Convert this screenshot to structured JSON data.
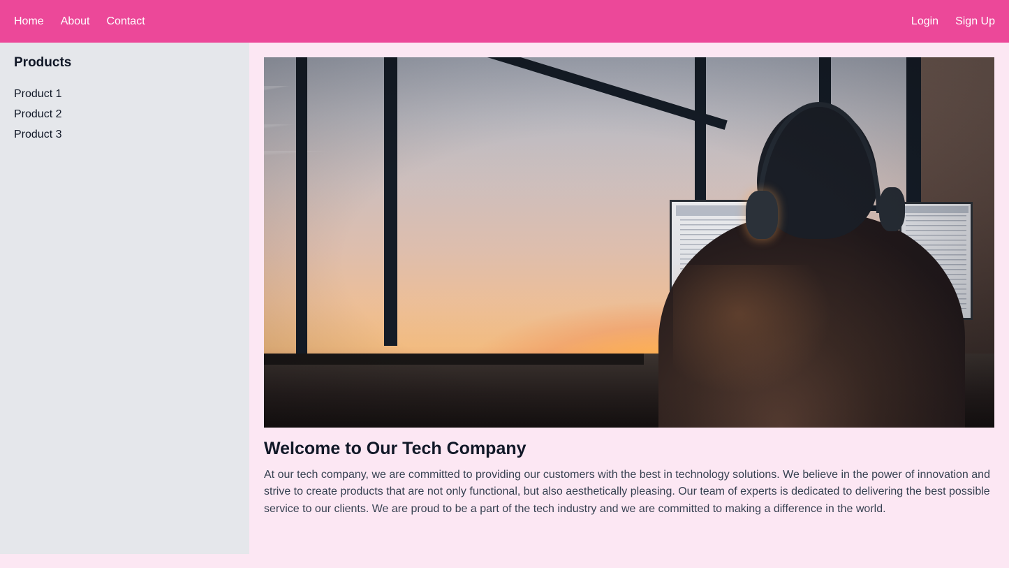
{
  "header": {
    "background_color": "#ec4899",
    "text_color": "#ffffff",
    "nav_left": [
      {
        "label": "Home"
      },
      {
        "label": "About"
      },
      {
        "label": "Contact"
      }
    ],
    "nav_right": [
      {
        "label": "Login"
      },
      {
        "label": "Sign Up"
      }
    ]
  },
  "sidebar": {
    "background_color": "#e5e7eb",
    "title": "Products",
    "items": [
      {
        "label": "Product 1"
      },
      {
        "label": "Product 2"
      },
      {
        "label": "Product 3"
      }
    ]
  },
  "main": {
    "background_color": "#fce7f3",
    "hero": {
      "alt": "Silhouette of a person wearing headphones working at a desk with computer monitors in front of large windows at sunset",
      "icon": "hero-photo"
    },
    "article": {
      "title": "Welcome to Our Tech Company",
      "body": "At our tech company, we are committed to providing our customers with the best in technology solutions. We believe in the power of innovation and strive to create products that are not only functional, but also aesthetically pleasing. Our team of experts is dedicated to delivering the best possible service to our clients. We are proud to be a part of the tech industry and we are committed to making a difference in the world.",
      "title_color": "#111827",
      "body_color": "#374151"
    }
  }
}
